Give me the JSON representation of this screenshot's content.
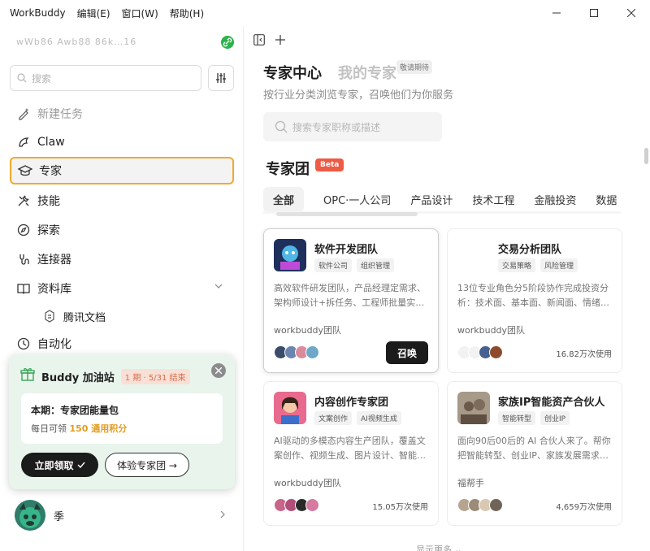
{
  "app": {
    "title": "WorkBuddy",
    "menus": [
      "编辑(E)",
      "窗口(W)",
      "帮助(H)"
    ]
  },
  "sidebar": {
    "account_label": "wWb86 Awb88 86k…16",
    "search_placeholder": "搜索",
    "nav": [
      {
        "key": "new-task",
        "label": "新建任务",
        "icon": "pen-sparkle-icon"
      },
      {
        "key": "claw",
        "label": "Claw",
        "icon": "claw-icon"
      },
      {
        "key": "expert",
        "label": "专家",
        "icon": "graduation-cap-icon",
        "active": true
      },
      {
        "key": "skills",
        "label": "技能",
        "icon": "tools-icon"
      },
      {
        "key": "explore",
        "label": "探索",
        "icon": "compass-icon"
      },
      {
        "key": "connectors",
        "label": "连接器",
        "icon": "plug-icon"
      },
      {
        "key": "library",
        "label": "资料库",
        "icon": "book-icon"
      },
      {
        "key": "tencent-docs",
        "label": "腾讯文档",
        "icon": "docs-icon"
      },
      {
        "key": "automation",
        "label": "自动化",
        "icon": "clock-icon"
      }
    ],
    "buddy": {
      "title": "Buddy 加油站",
      "period": "1 期 · 5/31 结束",
      "current_label": "本期：专家团能量包",
      "daily_prefix": "每日可领",
      "daily_amount": "150 通用积分",
      "claim_label": "立即领取",
      "trial_label": "体验专家团 →"
    },
    "user": {
      "name": "季"
    }
  },
  "main": {
    "tab_expert": "专家中心",
    "tab_mine": "我的专家",
    "waiting_badge": "敬请期待",
    "subtitle": "按行业分类浏览专家，召唤他们为你服务",
    "search_placeholder": "搜索专家职称或描述",
    "section_title": "专家团",
    "beta_label": "Beta",
    "categories": [
      "全部",
      "OPC·一人公司",
      "产品设计",
      "技术工程",
      "金融投资",
      "数据"
    ],
    "cards": [
      {
        "title": "软件开发团队",
        "tags": [
          "软件公司",
          "组织管理"
        ],
        "desc": "高效软件研发团队，产品经理定需求、架构师设计+拆任务、工程师批量实…",
        "author": "workbuddy团队",
        "action": "召唤",
        "accent": "#2a3b6e"
      },
      {
        "title": "交易分析团队",
        "tags": [
          "交易策略",
          "风险管理"
        ],
        "desc": "13位专业角色分5阶段协作完成投资分析：技术面、基本面、新闻面、情绪…",
        "author": "workbuddy团队",
        "uses": "16.82万次使用",
        "accent": "#ffffff"
      },
      {
        "title": "内容创作专家团",
        "tags": [
          "文案创作",
          "AI视频生成"
        ],
        "desc": "AI驱动的多模态内容生产团队，覆盖文案创作、视频生成、图片设计、智能…",
        "author": "workbuddy团队",
        "uses": "15.05万次使用",
        "accent": "#e0577c"
      },
      {
        "title": "家族IP智能资产合伙人",
        "tags": [
          "智能转型",
          "创业IP"
        ],
        "desc": "面向90后00后的 AI 合伙人来了。帮你把智能转型、创业IP、家族发展需求…",
        "author": "福帮手",
        "uses": "4,659万次使用",
        "accent": "#8a7a6a"
      }
    ],
    "show_more": "显示更多 ⌄"
  },
  "colors": {
    "active_border": "#f1a932",
    "buddy_bg": "#e9f5ec",
    "beta_bg": "#ef5a44",
    "highlight": "#e39c20"
  }
}
